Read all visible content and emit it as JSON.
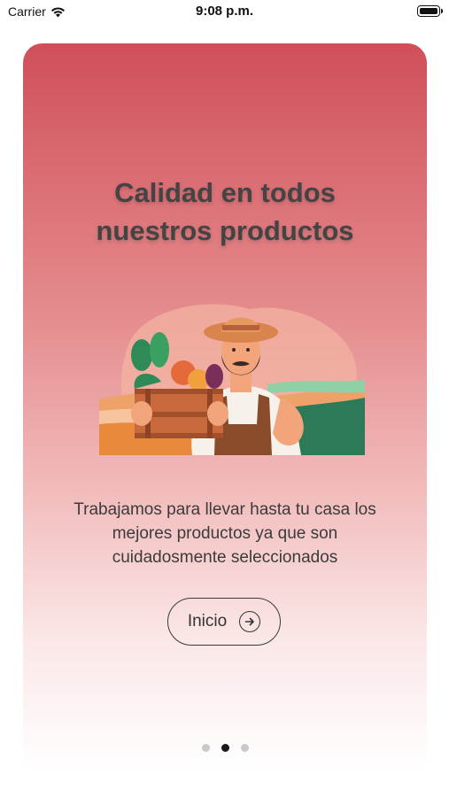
{
  "status_bar": {
    "carrier": "Carrier",
    "time": "9:08 p.m.",
    "wifi_icon": "wifi-icon",
    "battery_icon": "battery-icon"
  },
  "onboarding": {
    "title_line1": "Calidad en todos",
    "title_line2": "nuestros productos",
    "illustration": "farmer-with-vegetable-crate-illustration",
    "description_line1": "Trabajamos para llevar hasta tu casa los",
    "description_line2": "mejores productos ya que son",
    "description_line3": "cuidadosmente seleccionados",
    "button_label": "Inicio",
    "button_icon": "arrow-right-circle-icon",
    "page_count": 3,
    "current_page": 2
  },
  "colors": {
    "gradient_top": "#cf4f58",
    "gradient_bottom": "#ffffff",
    "title_text": "#444444",
    "dot_active": "#1a1a1a",
    "dot_inactive": "#c9c9c9"
  }
}
